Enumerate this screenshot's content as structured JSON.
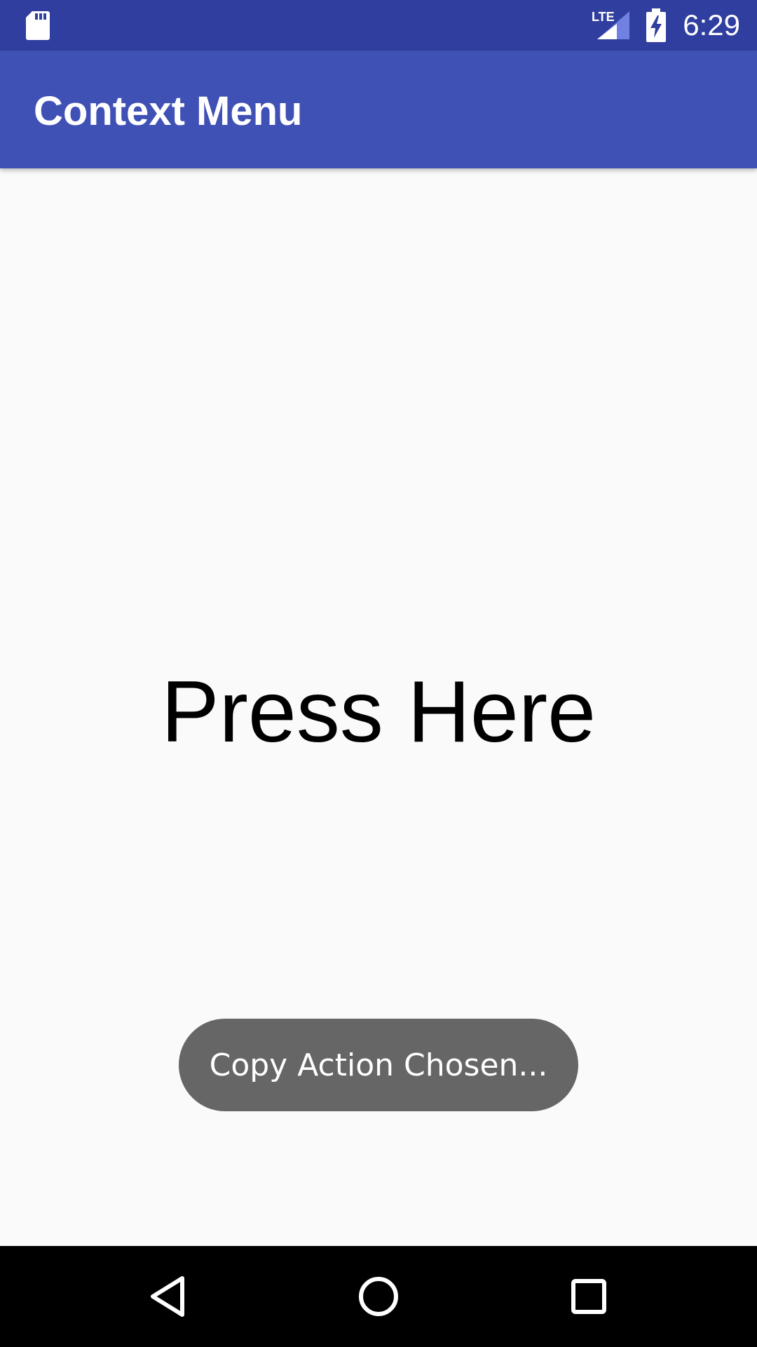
{
  "status_bar": {
    "time": "6:29",
    "network_label": "LTE",
    "icons": [
      "sd-card-icon",
      "lte-signal-icon",
      "battery-charging-icon"
    ],
    "color": "#303f9f"
  },
  "app_bar": {
    "title": "Context Menu",
    "color": "#3f51b5"
  },
  "main": {
    "press_text": "Press Here"
  },
  "toast": {
    "message": "Copy Action Chosen...",
    "color": "#666666"
  },
  "nav_bar": {
    "icons": [
      "back-icon",
      "home-icon",
      "recents-icon"
    ]
  }
}
